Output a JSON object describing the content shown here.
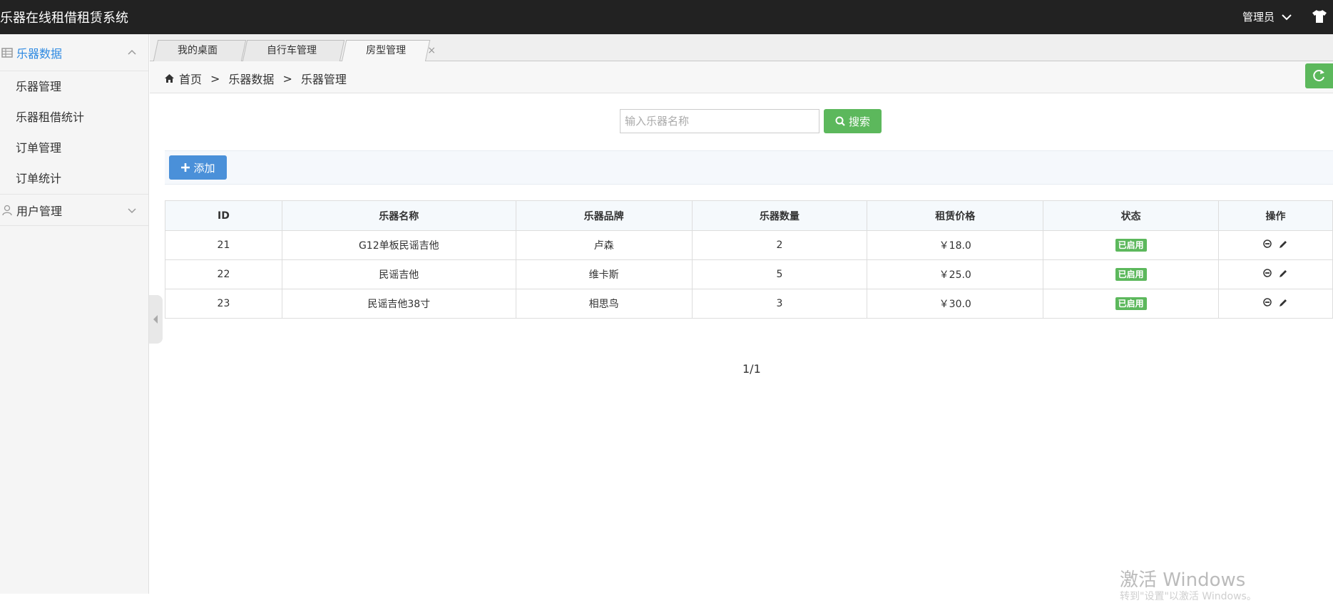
{
  "app": {
    "title": "乐器在线租借租赁系统",
    "user": "管理员"
  },
  "sidebar": {
    "groups": [
      {
        "label": "乐器数据",
        "expanded": true,
        "items": [
          {
            "label": "乐器管理"
          },
          {
            "label": "乐器租借统计"
          },
          {
            "label": "订单管理"
          },
          {
            "label": "订单统计"
          }
        ]
      },
      {
        "label": "用户管理",
        "expanded": false,
        "items": []
      }
    ]
  },
  "tabs": [
    {
      "label": "我的桌面",
      "closable": false
    },
    {
      "label": "自行车管理",
      "closable": true
    },
    {
      "label": "房型管理",
      "closable": true,
      "active": true
    }
  ],
  "tab_close_glyph": "×",
  "breadcrumb": {
    "items": [
      "首页",
      "乐器数据",
      "乐器管理"
    ],
    "separator": ">"
  },
  "search": {
    "placeholder": "输入乐器名称",
    "button_label": "搜索"
  },
  "toolbar": {
    "add_label": "添加"
  },
  "table": {
    "columns": [
      "ID",
      "乐器名称",
      "乐器品牌",
      "乐器数量",
      "租赁价格",
      "状态",
      "操作"
    ],
    "rows": [
      {
        "id": "21",
        "name": "G12单板民谣吉他",
        "brand": "卢森",
        "qty": "2",
        "price": "￥18.0",
        "status": "已启用"
      },
      {
        "id": "22",
        "name": "民谣吉他",
        "brand": "维卡斯",
        "qty": "5",
        "price": "￥25.0",
        "status": "已启用"
      },
      {
        "id": "23",
        "name": "民谣吉他38寸",
        "brand": "相思鸟",
        "qty": "3",
        "price": "￥30.0",
        "status": "已启用"
      }
    ]
  },
  "pagination": {
    "text": "1/1"
  },
  "watermark": {
    "line1": "激活 Windows",
    "line2": "转到\"设置\"以激活 Windows。"
  },
  "colors": {
    "header_bg": "#222222",
    "accent_blue": "#2f8ae2",
    "success_green": "#5cb85c",
    "primary_blue": "#4a90d9"
  },
  "icons": {
    "sidebar_group_1": "grid-icon",
    "sidebar_group_2": "user-icon",
    "header_right": "shirt-icon",
    "refresh": "refresh-icon",
    "row_op_1": "disable-icon",
    "row_op_2": "edit-icon"
  }
}
